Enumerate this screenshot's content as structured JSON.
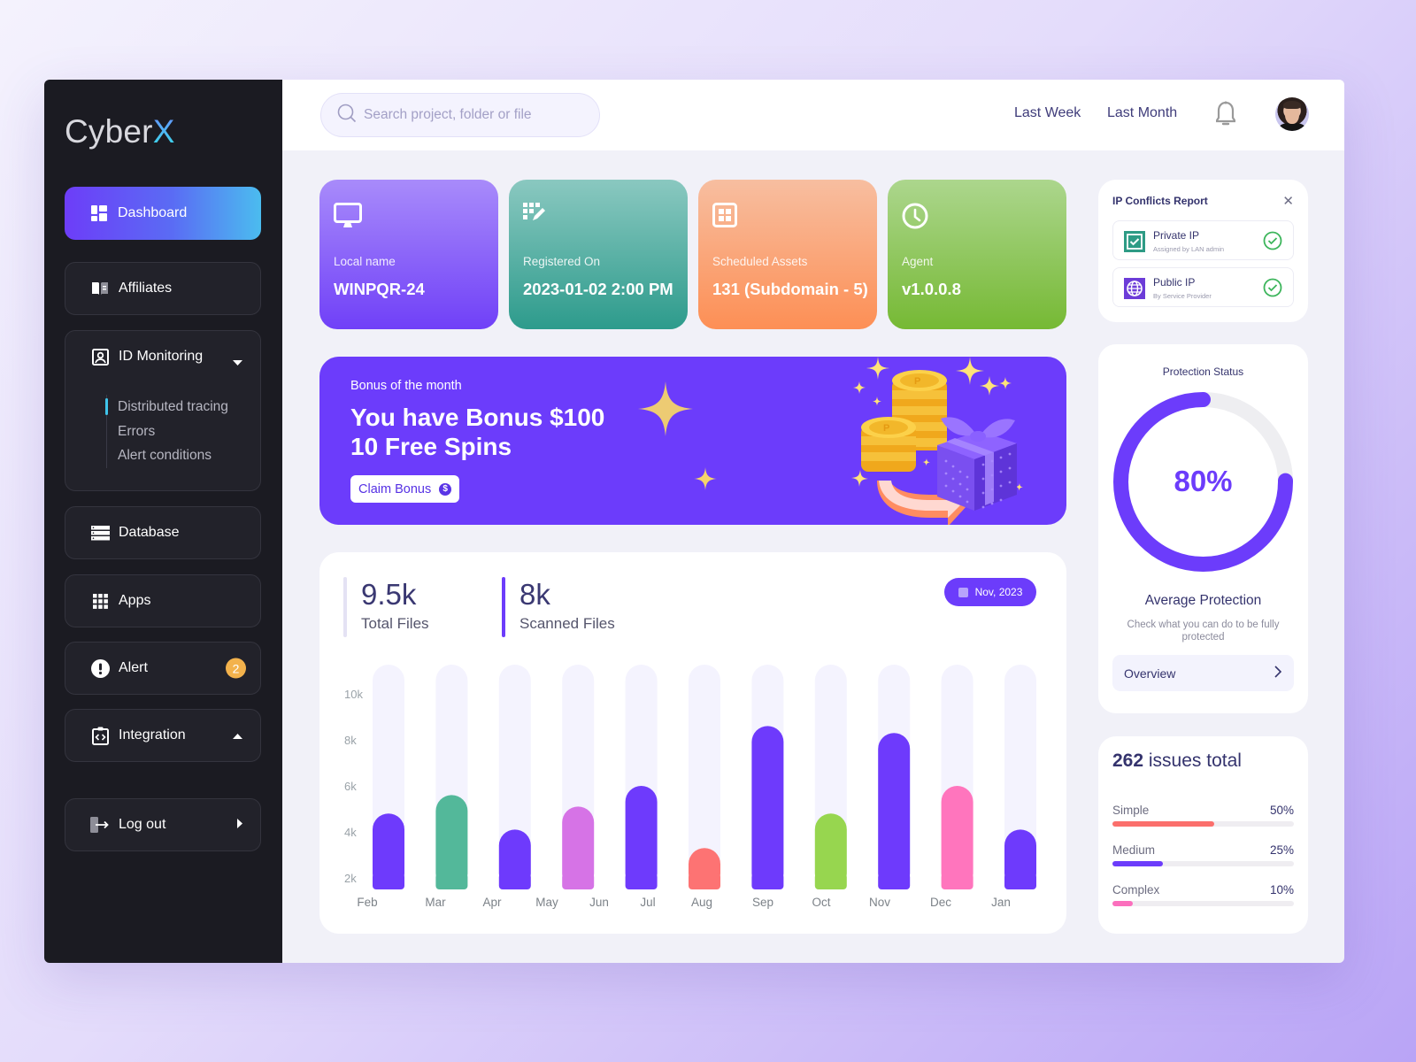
{
  "app": {
    "logo_main": "Cyber",
    "logo_accent": "X"
  },
  "sidebar": {
    "items": [
      {
        "label": "Dashboard",
        "icon": "dashboard-grid-icon",
        "active": true
      },
      {
        "label": "Affiliates",
        "icon": "book-icon"
      },
      {
        "label": "ID Monitoring",
        "icon": "id-badge-icon",
        "expanded": true,
        "children": [
          "Distributed tracing",
          "Errors",
          "Alert conditions"
        ]
      },
      {
        "label": "Database",
        "icon": "database-icon"
      },
      {
        "label": "Apps",
        "icon": "apps-grid-icon"
      },
      {
        "label": "Alert",
        "icon": "alert-icon",
        "badge": "2"
      },
      {
        "label": "Integration",
        "icon": "code-clipboard-icon"
      },
      {
        "label": "Log out",
        "icon": "logout-icon"
      }
    ]
  },
  "topbar": {
    "search_placeholder": "Search project, folder or file",
    "links": [
      "Last Week",
      "Last Month"
    ],
    "notification_icon": "bell-icon",
    "avatar": "user-avatar"
  },
  "info_cards": [
    {
      "label": "Local name",
      "value": "WINPQR-24",
      "icon": "monitor-icon"
    },
    {
      "label": "Registered On",
      "value": "2023-01-02 2:00 PM",
      "icon": "grid-edit-icon"
    },
    {
      "label": "Scheduled Assets",
      "value": "131 (Subdomain - 5)",
      "icon": "grid-box-icon"
    },
    {
      "label": "Agent",
      "value": "v1.0.0.8",
      "icon": "clock-icon"
    }
  ],
  "bonus": {
    "eyebrow": "Bonus of the month",
    "headline_line1": "You have Bonus $100",
    "headline_line2": "10 Free Spins",
    "button_label": "Claim Bonus",
    "button_icon": "dollar-coin-icon"
  },
  "files": {
    "total_value": "9.5k",
    "total_label": "Total Files",
    "scanned_value": "8k",
    "scanned_label": "Scanned Files",
    "date_filter": "Nov, 2023"
  },
  "chart_data": {
    "type": "bar",
    "title": "",
    "xlabel": "",
    "ylabel": "",
    "ylim": [
      1500,
      10500
    ],
    "y_ticks": [
      "10k",
      "8k",
      "6k",
      "4k",
      "2k"
    ],
    "y_tick_values": [
      10000,
      8000,
      6000,
      4000,
      2000
    ],
    "x_tick_labels": [
      "Feb",
      "Mar",
      "Apr",
      "May",
      "Jun",
      "Jul",
      "Aug",
      "Sep",
      "Oct",
      "Nov",
      "Dec",
      "Jan"
    ],
    "bars": [
      {
        "value": 4800,
        "color": "#6e3afc"
      },
      {
        "value": 5600,
        "color": "#53b89a"
      },
      {
        "value": 4100,
        "color": "#6e3afc"
      },
      {
        "value": 5100,
        "color": "#d673e6"
      },
      {
        "value": 6000,
        "color": "#6e3afc"
      },
      {
        "value": 3300,
        "color": "#fd7373"
      },
      {
        "value": 8600,
        "color": "#6e3afc"
      },
      {
        "value": 4800,
        "color": "#97d64f"
      },
      {
        "value": 8300,
        "color": "#6e3afc"
      },
      {
        "value": 6000,
        "color": "#ff75bd"
      },
      {
        "value": 4100,
        "color": "#6e3afc"
      }
    ],
    "track_max": 11000,
    "grid": false,
    "legend": "none"
  },
  "ip_report": {
    "title": "IP Conflicts Report",
    "rows": [
      {
        "name": "Private IP",
        "desc": "Assigned by LAN admin",
        "icon": "checkbox-icon",
        "status": "ok"
      },
      {
        "name": "Public IP",
        "desc": "By Service Provider",
        "icon": "globe-icon",
        "status": "ok"
      }
    ]
  },
  "protection": {
    "title": "Protection Status",
    "percent": 80,
    "percent_label": "80%",
    "heading": "Average Protection",
    "hint": "Check what you can do to be fully protected",
    "button_label": "Overview"
  },
  "issues": {
    "total": "262",
    "total_suffix": "issues total",
    "items": [
      {
        "name": "Simple",
        "pct_label": "50%",
        "pct": 50,
        "color": "#fb6f6c"
      },
      {
        "name": "Medium",
        "pct_label": "25%",
        "pct": 25,
        "color": "#6c3cfb"
      },
      {
        "name": "Complex",
        "pct_label": "10%",
        "pct": 10,
        "color": "#fb6fbd"
      }
    ]
  },
  "colors": {
    "accent": "#6c3cfb",
    "sidebar_bg": "#1b1b22",
    "badge": "#f3b24c"
  }
}
